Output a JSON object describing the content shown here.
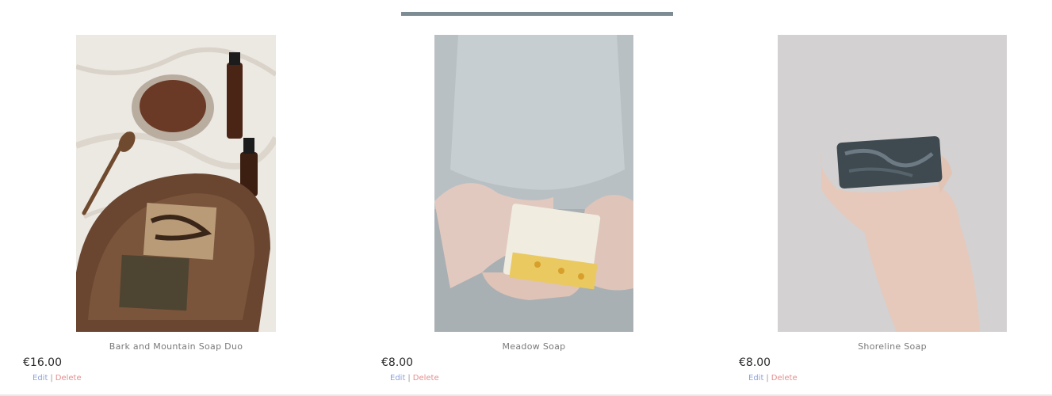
{
  "products": [
    {
      "name": "Bark and Mountain Soap Duo",
      "price": "€16.00",
      "edit_label": "Edit",
      "separator": "|",
      "delete_label": "Delete"
    },
    {
      "name": "Meadow Soap",
      "price": "€8.00",
      "edit_label": "Edit",
      "separator": "|",
      "delete_label": "Delete"
    },
    {
      "name": "Shoreline Soap",
      "price": "€8.00",
      "edit_label": "Edit",
      "separator": "|",
      "delete_label": "Delete"
    }
  ],
  "colors": {
    "divider": "#7d8b93",
    "edit_link": "#8ea3d8",
    "delete_link": "#e58e8e"
  }
}
